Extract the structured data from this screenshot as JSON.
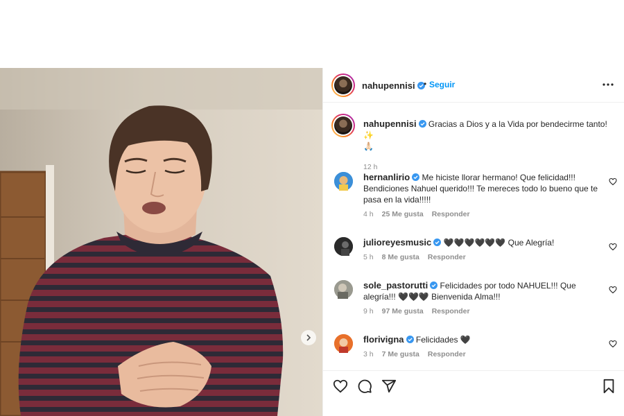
{
  "post": {
    "username": "nahupennisi",
    "separator": "•",
    "follow_label": "Seguir",
    "caption": "Gracias a Dios y a la Vida por bendecirme tanto! ✨",
    "caption_line2": "🙏🏻",
    "caption_time": "12 h"
  },
  "comments": [
    {
      "username": "hernanlirio",
      "text": "Me hiciste llorar hermano! Que felicidad!!! Bendiciones Nahuel querido!!! Te mereces todo lo bueno que te pasa en la vida!!!!!",
      "time": "4 h",
      "likes": "25 Me gusta",
      "reply": "Responder",
      "avatar_color": "#3b8fd8"
    },
    {
      "username": "julioreyesmusic",
      "text": "🖤🖤🖤🖤🖤🖤 Que Alegría!",
      "time": "5 h",
      "likes": "8 Me gusta",
      "reply": "Responder",
      "avatar_color": "#2a2a2a"
    },
    {
      "username": "sole_pastorutti",
      "text": "Felicidades por todo NAHUEL!!! Que alegría!!! 🖤🖤🖤 Bienvenida Alma!!!",
      "time": "9 h",
      "likes": "97 Me gusta",
      "reply": "Responder",
      "avatar_color": "#8a8a80"
    },
    {
      "username": "florivigna",
      "text": "Felicidades 🖤",
      "time": "3 h",
      "likes": "7 Me gusta",
      "reply": "Responder",
      "avatar_color": "#e8702a"
    }
  ],
  "icons": {
    "verified": "verified-badge-icon",
    "more": "more-options-icon",
    "like": "heart-icon",
    "comment": "comment-icon",
    "share": "share-icon",
    "save": "bookmark-icon",
    "next": "chevron-right-icon"
  },
  "colors": {
    "link_blue": "#0095f6",
    "verified_blue": "#3897f0",
    "meta_gray": "#8e8e8e"
  }
}
